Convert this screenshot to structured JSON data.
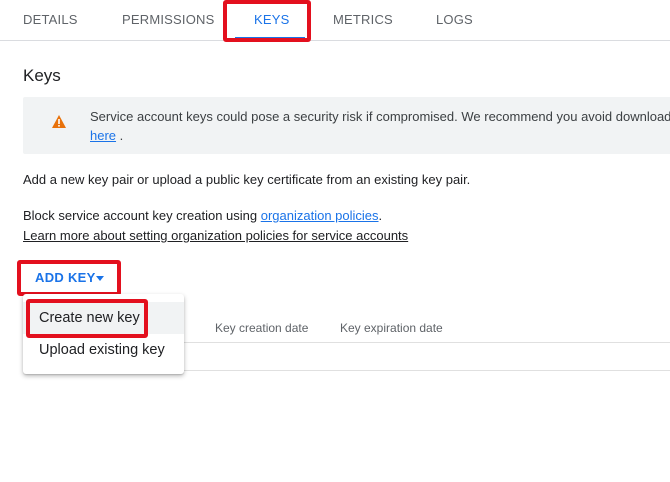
{
  "tabs": [
    {
      "label": "DETAILS",
      "active": false
    },
    {
      "label": "PERMISSIONS",
      "active": false
    },
    {
      "label": "KEYS",
      "active": true
    },
    {
      "label": "METRICS",
      "active": false
    },
    {
      "label": "LOGS",
      "active": false
    }
  ],
  "section_title": "Keys",
  "warning": {
    "icon": "warning-icon",
    "text_line1": "Service account keys could pose a security risk if compromised. We recommend you avoid download",
    "link_here": "here",
    "text_line2_suffix": " ."
  },
  "add_key_text": "Add a new key pair or upload a public key certificate from an existing key pair.",
  "policy": {
    "prefix": "Block service account key creation using ",
    "link": "organization policies",
    "suffix": ".",
    "learn_more": "Learn more about setting organization policies for service accounts"
  },
  "add_key_button": {
    "label": "ADD KEY",
    "icon": "caret-down-icon"
  },
  "table": {
    "columns": [
      "Key creation date",
      "Key expiration date"
    ]
  },
  "menu": {
    "items": [
      "Create new key",
      "Upload existing key"
    ]
  },
  "colors": {
    "accent": "#1a73e8",
    "highlight_box": "#e3101e",
    "warning_icon": "#e8710a"
  }
}
